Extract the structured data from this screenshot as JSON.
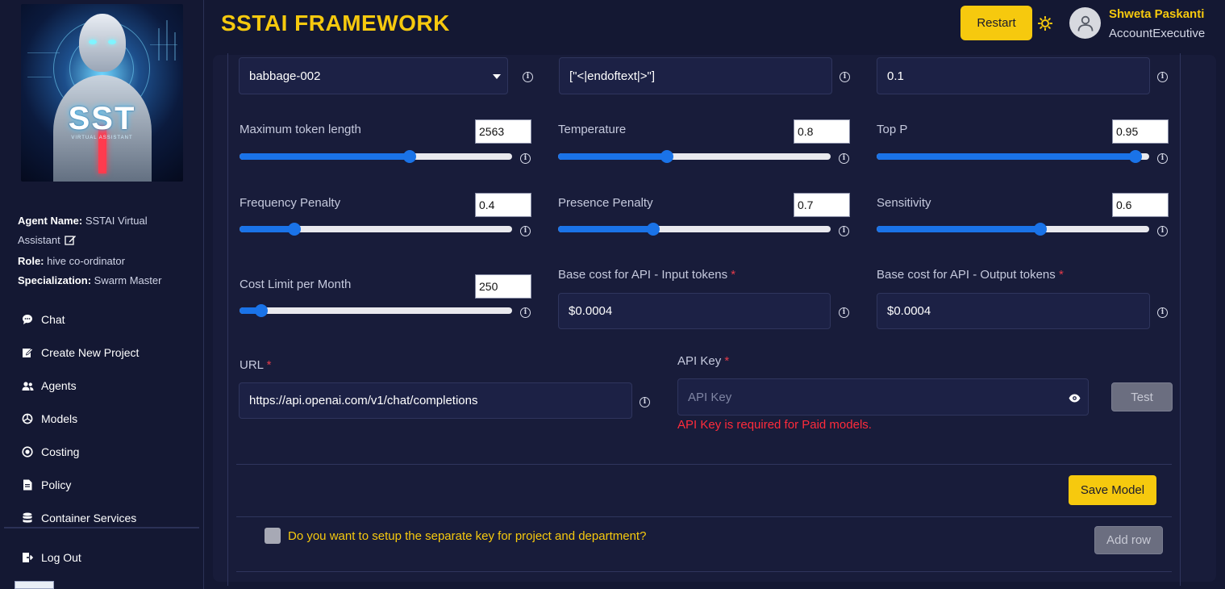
{
  "app": {
    "title": "SSTAI FRAMEWORK"
  },
  "header": {
    "restart_label": "Restart",
    "user_name": "Shweta Paskanti",
    "user_role": "AccountExecutive"
  },
  "logo": {
    "text": "SST",
    "subtext": "VIRTUAL ASSISTANT"
  },
  "agent": {
    "name_label": "Agent Name:",
    "name_value": "SSTAI Virtual Assistant",
    "role_label": "Role:",
    "role_value": "hive co-ordinator",
    "spec_label": "Specialization:",
    "spec_value": "Swarm Master"
  },
  "sidebar": {
    "items": [
      {
        "label": "Chat",
        "icon": "chat-icon"
      },
      {
        "label": "Create New Project",
        "icon": "edit-icon"
      },
      {
        "label": "Agents",
        "icon": "users-icon"
      },
      {
        "label": "Models",
        "icon": "openai-icon"
      },
      {
        "label": "Costing",
        "icon": "coin-icon"
      },
      {
        "label": "Policy",
        "icon": "document-icon"
      },
      {
        "label": "Container Services",
        "icon": "database-icon"
      }
    ],
    "logout_label": "Log Out"
  },
  "form": {
    "model_select": "babbage-002",
    "stop_sequence": "[\"<|endoftext|>\"]",
    "top_value_field": "0.1",
    "sliders": {
      "max_tokens": {
        "label": "Maximum token length",
        "value": "2563",
        "fraction": 0.625
      },
      "temperature": {
        "label": "Temperature",
        "value": "0.8",
        "fraction": 0.4
      },
      "top_p": {
        "label": "Top P",
        "value": "0.95",
        "fraction": 0.95
      },
      "frequency_penalty": {
        "label": "Frequency Penalty",
        "value": "0.4",
        "fraction": 0.2
      },
      "presence_penalty": {
        "label": "Presence Penalty",
        "value": "0.7",
        "fraction": 0.35
      },
      "sensitivity": {
        "label": "Sensitivity",
        "value": "0.6",
        "fraction": 0.6
      },
      "cost_limit": {
        "label": "Cost Limit per Month",
        "value": "250",
        "fraction": 0.08
      }
    },
    "input_cost": {
      "label": "Base cost for API - Input tokens",
      "required": "*",
      "value": "$0.0004"
    },
    "output_cost": {
      "label": "Base cost for API - Output tokens",
      "required": "*",
      "value": "$0.0004"
    },
    "url": {
      "label": "URL",
      "required": "*",
      "value": "https://api.openai.com/v1/chat/completions"
    },
    "api_key": {
      "label": "API Key",
      "required": "*",
      "placeholder": "API Key",
      "error": "API Key is required for Paid models."
    },
    "test_label": "Test",
    "save_label": "Save Model",
    "separate_key_question": "Do you want to setup the separate key for project and department?",
    "add_row_label": "Add row"
  },
  "colors": {
    "accent": "#f6c90e",
    "background": "#141833",
    "slider": "#1a73e8",
    "error": "#ff2b3b"
  }
}
